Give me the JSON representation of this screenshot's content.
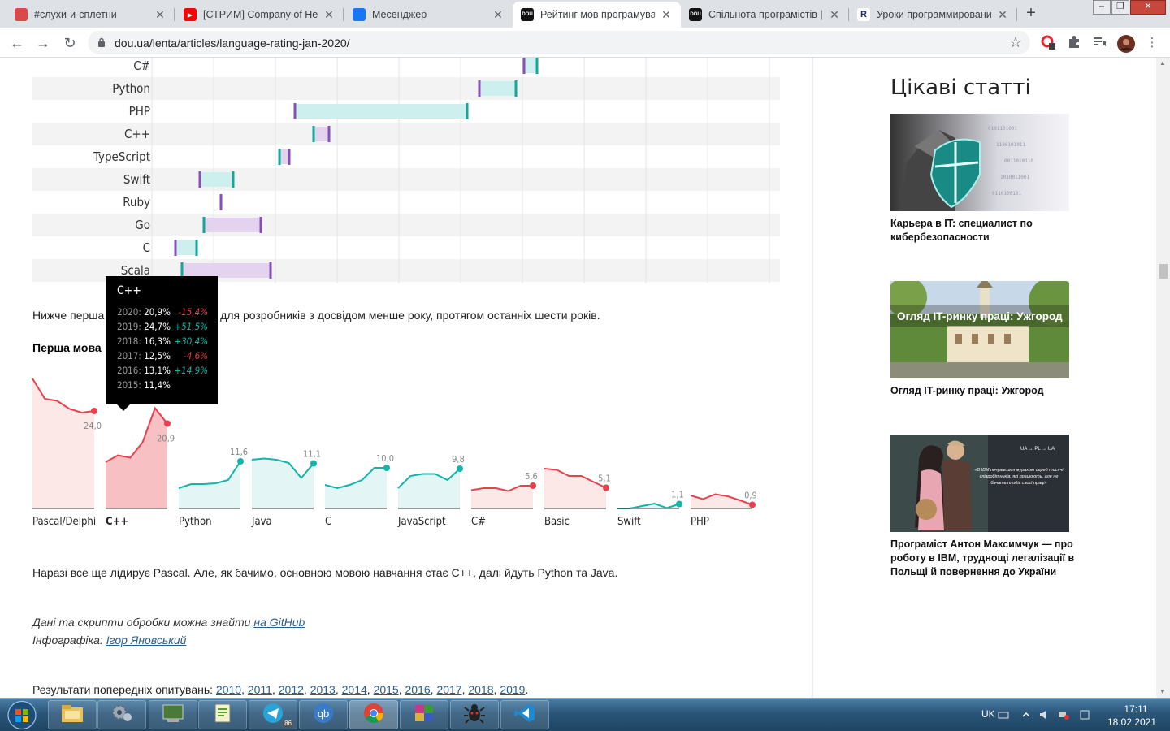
{
  "tabs": [
    {
      "title": "#слухи-и-сплетни",
      "icon": "slack-icon",
      "color": "#d94a4a"
    },
    {
      "title": "[СТРИМ] Company of Heroes",
      "icon": "youtube-icon",
      "color": "#ff0000"
    },
    {
      "title": "Месенджер",
      "icon": "messenger-icon",
      "color": "#1877f2"
    },
    {
      "title": "Рейтинг мов програмування",
      "icon": "dou-icon",
      "color": "#111111"
    },
    {
      "title": "Спільнота програмістів | DOU",
      "icon": "dou-icon",
      "color": "#111111"
    },
    {
      "title": "Уроки программирования",
      "icon": "r-icon",
      "color": "#ffffff"
    }
  ],
  "address_bar": {
    "url": "dou.ua/lenta/articles/language-rating-jan-2020/"
  },
  "range_chart": {
    "type": "range",
    "rows": [
      {
        "label": "C#",
        "a": 605,
        "b": 621
      },
      {
        "label": "Python",
        "a": 550,
        "b": 595
      },
      {
        "label": "PHP",
        "a": 323,
        "b": 535
      },
      {
        "label": "C++",
        "a": 346,
        "b": 365
      },
      {
        "label": "TypeScript",
        "a": 304,
        "b": 316
      },
      {
        "label": "Swift",
        "a": 206,
        "b": 247
      },
      {
        "label": "Ruby",
        "a": 232,
        "b": 232
      },
      {
        "label": "Go",
        "a": 211,
        "b": 281
      },
      {
        "label": "C",
        "a": 176,
        "b": 202
      },
      {
        "label": "Scala",
        "a": 184,
        "b": 293
      }
    ]
  },
  "article": {
    "intro_text": "Нижче перша мова програмування для розробників з досвідом менше року, протягом останніх шести років.",
    "section_title": "Перша мова",
    "conclusion": "Наразі все ще лідирує Pascal. Але, як бачимо, основною мовою навчання стає C++, далі йдуть Python та Java.",
    "credits_data_prefix": "Дані та скрипти обробки можна знайти ",
    "credits_data_link": "на GitHub",
    "credits_infographic_prefix": "Інфографіка: ",
    "credits_infographic_link": "Ігор Яновський",
    "previous_prefix": "Результати попередніх опитувань: ",
    "previous_years": [
      "2010",
      "2011",
      "2012",
      "2013",
      "2014",
      "2015",
      "2016",
      "2017",
      "2018",
      "2019"
    ],
    "previous_suffix": "."
  },
  "chart_data": {
    "type": "line",
    "x": [
      "2015",
      "2016",
      "2017",
      "2018",
      "2019",
      "2020"
    ],
    "series": [
      {
        "name": "Pascal/Delphi",
        "values": [
          32.0,
          27.0,
          26.5,
          24.5,
          23.6,
          24.0
        ],
        "label": "24,0",
        "trend": "down"
      },
      {
        "name": "C++",
        "values": [
          11.4,
          13.1,
          12.5,
          16.3,
          24.7,
          20.9
        ],
        "label": "20,9",
        "trend": "down",
        "highlight": true
      },
      {
        "name": "Python",
        "values": [
          5.0,
          6.0,
          6.0,
          6.2,
          7.0,
          11.6
        ],
        "label": "11,6",
        "trend": "up"
      },
      {
        "name": "Java",
        "values": [
          12.0,
          12.3,
          12.0,
          11.2,
          7.5,
          11.1
        ],
        "label": "11,1",
        "trend": "up"
      },
      {
        "name": "C",
        "values": [
          5.8,
          5.0,
          5.8,
          7.0,
          10.0,
          10.0
        ],
        "label": "10,0",
        "trend": "up"
      },
      {
        "name": "JavaScript",
        "values": [
          5.0,
          8.0,
          8.5,
          8.5,
          7.0,
          9.8
        ],
        "label": "9,8",
        "trend": "up"
      },
      {
        "name": "C#",
        "values": [
          4.5,
          5.0,
          5.0,
          4.3,
          5.6,
          5.6
        ],
        "label": "5,6",
        "trend": "down"
      },
      {
        "name": "Basic",
        "values": [
          9.8,
          9.5,
          8.0,
          8.0,
          6.5,
          5.1
        ],
        "label": "5,1",
        "trend": "down"
      },
      {
        "name": "Swift",
        "values": [
          0.0,
          0.0,
          0.6,
          1.2,
          0.1,
          1.1
        ],
        "label": "1,1",
        "trend": "up"
      },
      {
        "name": "PHP",
        "values": [
          3.2,
          2.3,
          3.5,
          3.0,
          2.0,
          0.9
        ],
        "label": "0,9",
        "trend": "down"
      }
    ],
    "colors": {
      "up": "#12b5a6",
      "down": "#e8414d",
      "up_fill": "#e3f6f5",
      "down_fill": "#fde8e8",
      "highlight_fill": "#f7c0c2"
    }
  },
  "tooltip": {
    "title": "C++",
    "rows": [
      {
        "year": "2020:",
        "value": "20,9%",
        "change": "-15,4%",
        "dir": "down"
      },
      {
        "year": "2019:",
        "value": "24,7%",
        "change": "+51,5%",
        "dir": "up"
      },
      {
        "year": "2018:",
        "value": "16,3%",
        "change": "+30,4%",
        "dir": "up"
      },
      {
        "year": "2017:",
        "value": "12,5%",
        "change": "-4,6%",
        "dir": "down"
      },
      {
        "year": "2016:",
        "value": "13,1%",
        "change": "+14,9%",
        "dir": "up"
      },
      {
        "year": "2015:",
        "value": "11,4%",
        "change": "",
        "dir": "none"
      }
    ]
  },
  "sidebar": {
    "title": "Цікаві статті",
    "cards": [
      {
        "caption": "Карьера в IT: специалист по кибербезопасности",
        "image": "knight-with-shield"
      },
      {
        "caption": "Огляд IT-ринку праці: Ужгород",
        "image": "uzhgorod-street",
        "overlay": "Огляд IT-ринку праці: Ужгород"
      },
      {
        "caption": "Програміст Антон Максимчук — про роботу в IBM, труднощі легалізації в Польщі й повернення до України",
        "image": "couple-photo",
        "overlay_tag": "UA → PL → UA",
        "overlay_quote": "«В IBM почуваєшся мурахою серед тисячі співробітників, які працюють, але не бачать плодів своєї праці»"
      }
    ]
  },
  "taskbar": {
    "apps": [
      "file-explorer-icon",
      "settings-gears-icon",
      "terminal-icon",
      "notepad-icon",
      "telegram-icon",
      "qbittorrent-icon",
      "chrome-icon",
      "winrar-icon",
      "bug-icon",
      "vscode-icon"
    ],
    "telegram_badge": "86",
    "language": "UK",
    "time": "17:11",
    "date": "18.02.2021"
  }
}
